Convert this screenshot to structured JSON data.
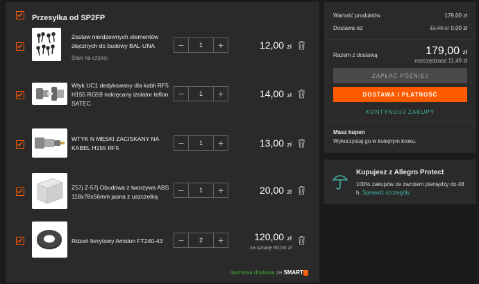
{
  "cart": {
    "seller_label": "Przesyłka od SP2FP",
    "items": [
      {
        "name": "Zestaw nierdzewnych elementów złącznych do budowy BAL-UNA",
        "subtitle": "Stan na części",
        "qty": "1",
        "price_main": "12,00",
        "price_cur": "zł",
        "unit_price": "",
        "icon": "hardware-set-thumbnail"
      },
      {
        "name": "Wtyk UC1 dedykowany dla kabli RF5 H155 RG59 nakręcany izolator teflon SATEC",
        "subtitle": "",
        "qty": "1",
        "price_main": "14,00",
        "price_cur": "zł",
        "unit_price": "",
        "icon": "connector-thumbnail"
      },
      {
        "name": "WTYK N MĘSKI ZACISKANY NA KABEL H155 RF5",
        "subtitle": "",
        "qty": "1",
        "price_main": "13,00",
        "price_cur": "zł",
        "unit_price": "",
        "icon": "n-connector-thumbnail"
      },
      {
        "name": "Z57j Z-57j Obudowa z tworzywa ABS 118x78x56mm jasna z uszczelką",
        "subtitle": "",
        "qty": "1",
        "price_main": "20,00",
        "price_cur": "zł",
        "unit_price": "",
        "icon": "enclosure-thumbnail"
      },
      {
        "name": "Rdzeń ferrytowy Amidon FT240-43",
        "subtitle": "",
        "qty": "2",
        "price_main": "120,00",
        "price_cur": "zł",
        "unit_price": "za sztukę 60,00 zł",
        "icon": "ferrite-core-thumbnail"
      }
    ],
    "footer": {
      "free": "darmowa dostawa",
      "with": "ze",
      "smart": "SMART",
      "smart_badge": "!"
    }
  },
  "summary": {
    "products_label": "Wartość produktów",
    "products_value": "179,00 zł",
    "delivery_label": "Dostawa od",
    "delivery_old": "11,49 zł",
    "delivery_value": "0,00 zł",
    "total_label": "Razem z dostawą",
    "total_main": "179,00",
    "total_cur": "zł",
    "saving": "oszczędzasz 11,49 zł",
    "btn_later": "ZAPŁAĆ PÓŹNIEJ",
    "btn_checkout": "DOSTAWA I PŁATNOŚĆ",
    "link_continue": "KONTYNUUJ ZAKUPY",
    "coupon_title": "Masz kupon",
    "coupon_sub": "Wykorzystaj go w kolejnym kroku."
  },
  "protect": {
    "title": "Kupujesz z Allegro Protect",
    "desc": "100% zakupów ze zwrotem pieniędzy do 48 h.",
    "link": "Sprawdź szczegóły"
  },
  "colors": {
    "accent": "#ff5a00",
    "link": "#3fb3a6",
    "green": "#3fa535"
  }
}
